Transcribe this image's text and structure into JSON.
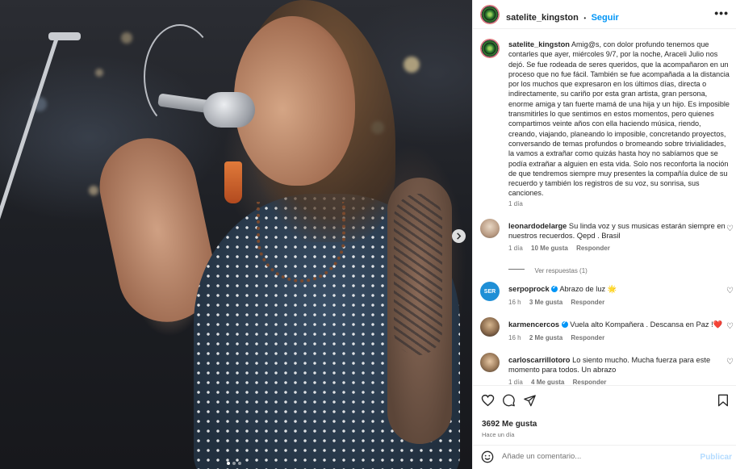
{
  "post": {
    "username": "satelite_kingston",
    "follow_separator": "•",
    "follow_label": "Seguir",
    "more_label": "•••",
    "caption": "Amig@s, con dolor profundo tenemos que contarles que ayer, miércoles 9/7, por la noche, Araceli Julio nos dejó. Se fue rodeada de seres queridos, que la acompañaron en un proceso que no fue fácil. También se fue acompañada a la distancia por los muchos que expresaron en los últimos días, directa o indirectamente, su cariño por esta gran artista, gran persona, enorme amiga y tan fuerte mamá de una hija y un hijo. Es imposible transmitirles lo que sentimos en estos momentos, pero quienes compartimos veinte años con ella haciendo música, riendo, creando, viajando, planeando lo imposible, concretando proyectos, conversando de temas profundos o bromeando sobre trivialidades, la vamos a extrañar como quizás hasta hoy no sabíamos que se podía extrañar a alguien en esta vida. Solo nos reconforta la noción de que tendremos siempre muy presentes la compañía dulce de su recuerdo y también los registros de su voz, su sonrisa, sus canciones.",
    "caption_time": "1 día",
    "likes_label": "3692 Me gusta",
    "posted": "Hace un día",
    "comment_placeholder": "Añade un comentario...",
    "publish_label": "Publicar",
    "carousel_dots": 3
  },
  "comments": [
    {
      "username": "leonardodelarge",
      "text": "Su linda voz y sus musicas estarán siempre en nuestros recuerdos. Qepd . Brasil",
      "time": "1 día",
      "likes": "10 Me gusta",
      "reply": "Responder",
      "view_replies": "Ver respuestas (1)",
      "verified": false
    },
    {
      "username": "serpoprock",
      "text": "Abrazo de luz 🌟",
      "time": "16 h",
      "likes": "3 Me gusta",
      "reply": "Responder",
      "verified": true
    },
    {
      "username": "karmencercos",
      "text": "Vuela alto Kompañera . Descansa en Paz !❤️",
      "time": "16 h",
      "likes": "2 Me gusta",
      "reply": "Responder",
      "verified": true
    },
    {
      "username": "carloscarrillotoro",
      "text": "Lo siento mucho. Mucha fuerza para este momento para todos. Un abrazo",
      "time": "1 día",
      "likes": "4 Me gusta",
      "reply": "Responder",
      "verified": false
    }
  ],
  "colors": {
    "accent": "#0095f6",
    "text": "#262626",
    "muted": "#737373",
    "publish_disabled": "#b3dbff"
  },
  "icons": {
    "like": "heart-icon",
    "comment": "speech-bubble-icon",
    "share": "paper-plane-icon",
    "save": "bookmark-icon",
    "emoji": "smiley-icon",
    "more": "ellipsis-icon",
    "next": "chevron-right-icon"
  }
}
